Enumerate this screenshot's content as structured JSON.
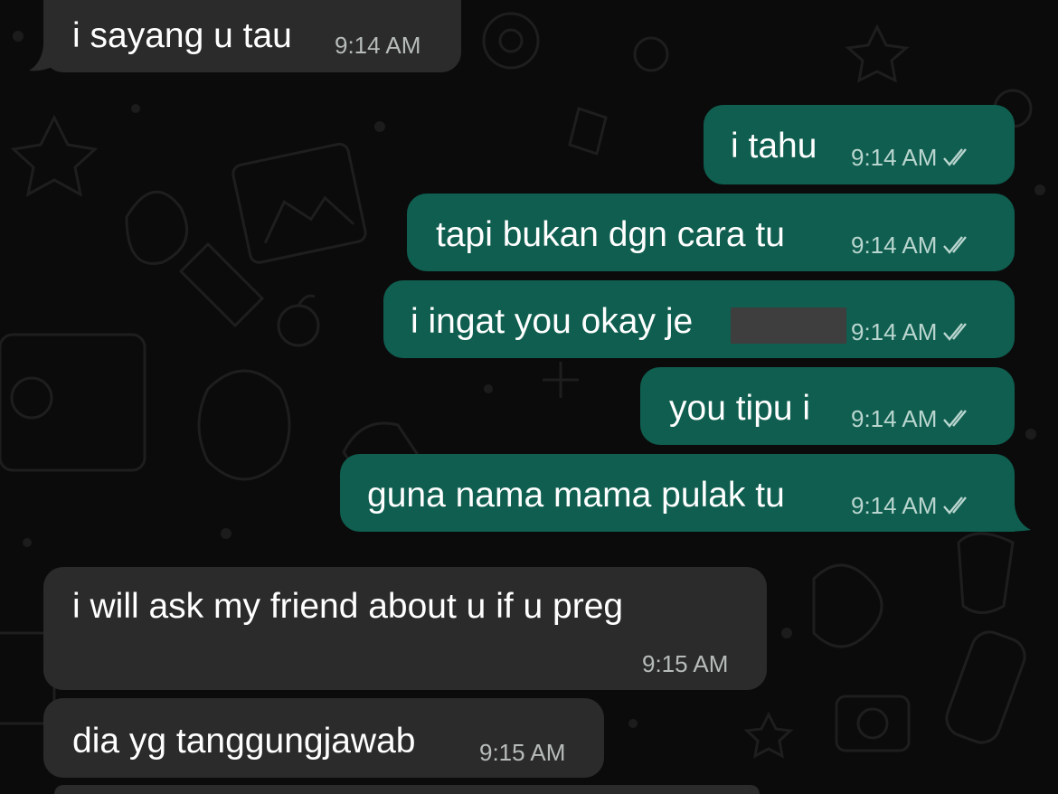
{
  "colors": {
    "background": "#0b0b0b",
    "incoming_bubble": "#2b2b2b",
    "outgoing_bubble": "#0f5e4f",
    "timestamp_in": "#b7bcbb",
    "timestamp_out": "#b9d5cf"
  },
  "messages": [
    {
      "direction": "incoming",
      "text": "i sayang u tau",
      "time": "9:14 AM"
    },
    {
      "direction": "outgoing",
      "text": "i tahu",
      "time": "9:14 AM",
      "status": "read-ticks"
    },
    {
      "direction": "outgoing",
      "text": "tapi bukan dgn cara tu",
      "time": "9:14 AM",
      "status": "read-ticks"
    },
    {
      "direction": "outgoing",
      "text": "i ingat you okay je",
      "time": "9:14 AM",
      "status": "read-ticks",
      "redacted": true
    },
    {
      "direction": "outgoing",
      "text": "you tipu i",
      "time": "9:14 AM",
      "status": "read-ticks"
    },
    {
      "direction": "outgoing",
      "text": "guna nama mama pulak tu",
      "time": "9:14 AM",
      "status": "read-ticks"
    },
    {
      "direction": "incoming",
      "text": "i will ask my friend about u if u preg",
      "time": "9:15 AM"
    },
    {
      "direction": "incoming",
      "text": "dia yg tanggungjawab",
      "time": "9:15 AM"
    }
  ]
}
